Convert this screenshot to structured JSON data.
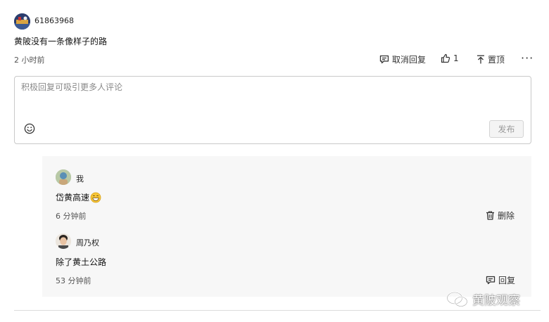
{
  "comment": {
    "username": "61863968",
    "text": "黄陂没有一条像样子的路",
    "time": "2 小时前",
    "actions": {
      "cancel_reply": "取消回复",
      "like_count": "1",
      "pin": "置顶",
      "more": "···"
    }
  },
  "reply_box": {
    "placeholder": "积极回复可吸引更多人评论",
    "publish_label": "发布"
  },
  "replies": [
    {
      "username": "我",
      "text": "岱黄高速",
      "time": "6 分钟前",
      "action_label": "删除"
    },
    {
      "username": "周乃权",
      "text": "除了黄土公路",
      "time": "53 分钟前",
      "action_label": "回复"
    }
  ],
  "watermark": {
    "text": "黄陂观察"
  },
  "colors": {
    "panel_bg": "#f7f7f7",
    "border": "#c9c9c9",
    "avatar_main": "#2b3d6e"
  }
}
